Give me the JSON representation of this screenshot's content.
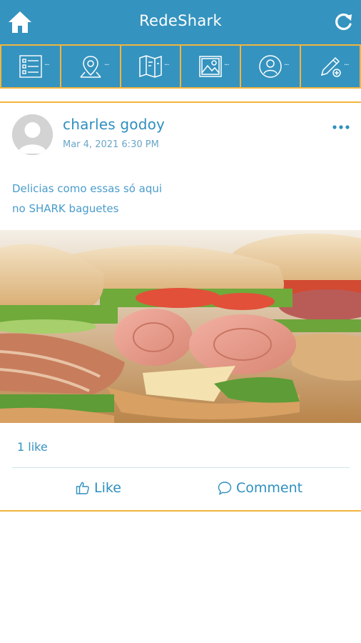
{
  "app": {
    "title": "RedeShark"
  },
  "topbar": {
    "home_icon": "home-icon",
    "refresh_icon": "refresh-icon",
    "background": "#3593bf",
    "accent": "#f2b53c"
  },
  "nav": {
    "items": [
      {
        "icon": "list-icon"
      },
      {
        "icon": "location-pin-icon"
      },
      {
        "icon": "map-icon"
      },
      {
        "icon": "gallery-icon"
      },
      {
        "icon": "user-profile-icon"
      },
      {
        "icon": "edit-icon"
      }
    ]
  },
  "post": {
    "author": "charles godoy",
    "date": "Mar 4, 2021 6:30 PM",
    "message_lines": [
      "Delicias como essas só aqui",
      "no SHARK baguetes"
    ],
    "likes": "1 like",
    "like_label": "Like",
    "comment_label": "Comment"
  }
}
